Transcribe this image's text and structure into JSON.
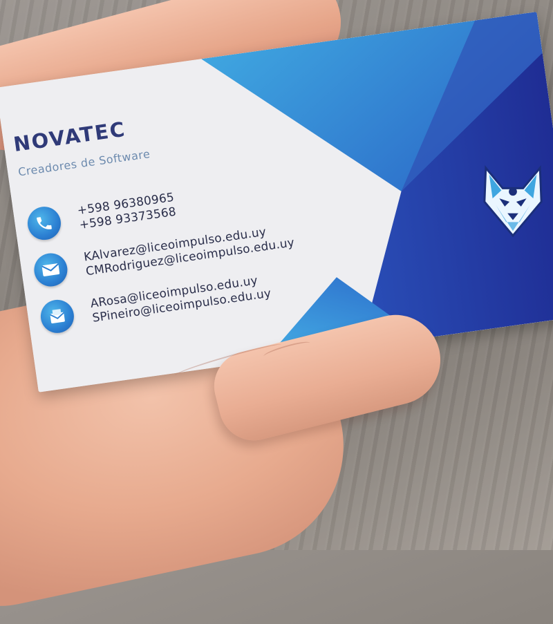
{
  "card": {
    "company_name": "NOVATEC",
    "tagline": "Creadores de Software",
    "contacts": [
      {
        "icon": "phone-icon",
        "lines": [
          "+598 96380965",
          "+598 93373568"
        ]
      },
      {
        "icon": "email-icon",
        "lines": [
          "KAlvarez@liceoimpulso.edu.uy",
          "CMRodriguez@liceoimpulso.edu.uy"
        ]
      },
      {
        "icon": "envelope-icon",
        "lines": [
          "ARosa@liceoimpulso.edu.uy",
          "SPineiro@liceoimpulso.edu.uy"
        ]
      }
    ],
    "logo": "wolf-logo-icon",
    "colors": {
      "card_white": "#eeeef1",
      "navy": "#25339a",
      "blue": "#2b66c8",
      "light_blue": "#3fa6e0",
      "title": "#2f3a78",
      "tagline": "#6c8aae"
    }
  }
}
